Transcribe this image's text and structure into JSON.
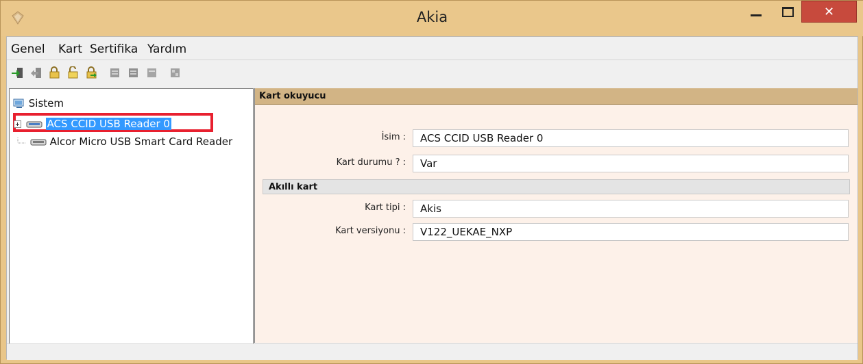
{
  "window": {
    "title": "Akia"
  },
  "menu": {
    "items": [
      "Genel",
      "Kart",
      "Sertifika",
      "Yardım"
    ]
  },
  "toolbar": {
    "icons": [
      "login-icon",
      "logout-icon",
      "lock-icon",
      "lock-open-icon",
      "lock-arrow-icon",
      "cert-import-icon",
      "cert-export-icon",
      "cert-delete-icon",
      "cert-grid-icon"
    ]
  },
  "tree": {
    "root": "Sistem",
    "children": [
      {
        "label": "ACS CCID USB Reader 0",
        "selected": true,
        "expandable": true
      },
      {
        "label": "Alcor Micro USB Smart Card Reader",
        "selected": false,
        "expandable": false
      }
    ]
  },
  "detail": {
    "section_title": "Kart okuyucu",
    "fields": [
      {
        "label": "İsim :",
        "value": "ACS CCID USB Reader 0"
      },
      {
        "label": "Kart durumu ? :",
        "value": "Var"
      }
    ],
    "subsection_title": "Akıllı kart",
    "subfields": [
      {
        "label": "Kart tipi :",
        "value": "Akis"
      },
      {
        "label": "Kart versiyonu :",
        "value": "V122_UEKAE_NXP"
      }
    ]
  },
  "colors": {
    "frame": "#eac78b",
    "close": "#c74a3d",
    "selection": "#3399ff",
    "highlight": "#e8202f",
    "section": "#d2b485",
    "panel_bg": "#fdf1e9"
  }
}
